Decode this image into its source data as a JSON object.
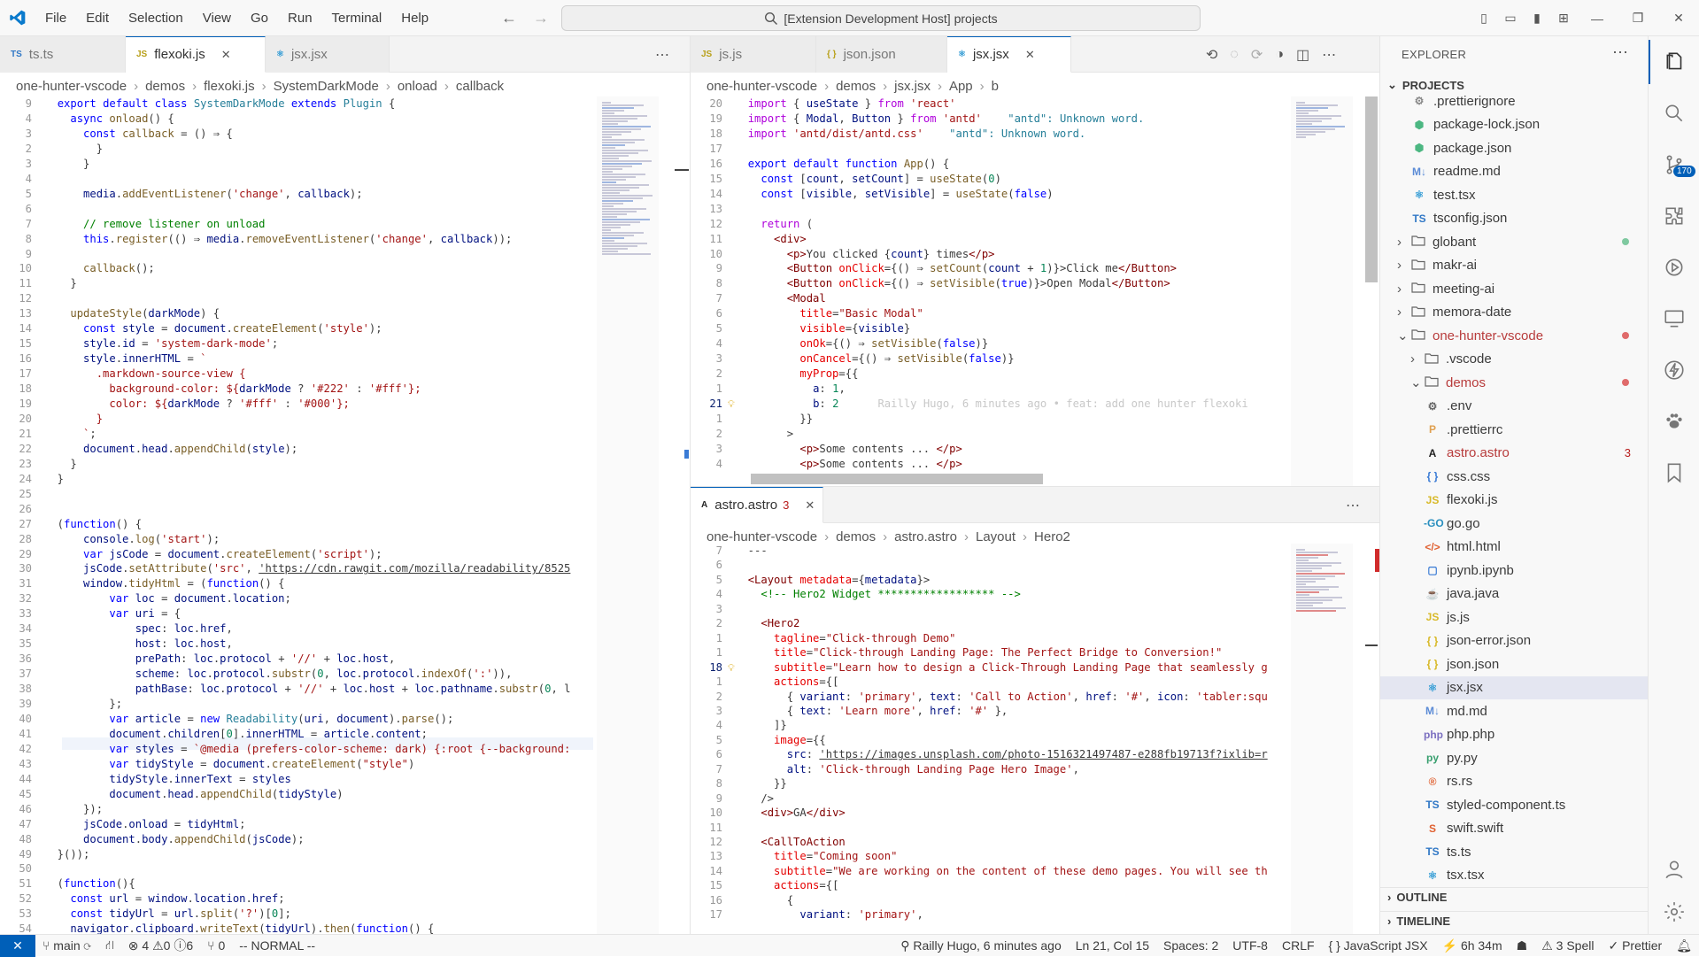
{
  "title_bar": {
    "menu": [
      "File",
      "Edit",
      "Selection",
      "View",
      "Go",
      "Run",
      "Terminal",
      "Help"
    ],
    "command_center": "[Extension Development Host] projects"
  },
  "left_editor": {
    "tabs": [
      {
        "label": "ts.ts",
        "icon": "TS"
      },
      {
        "label": "flexoki.js",
        "icon": "JS",
        "active": true
      },
      {
        "label": "jsx.jsx",
        "icon": "⚛"
      }
    ],
    "breadcrumb": [
      "one-hunter-vscode",
      "demos",
      "flexoki.js",
      "SystemDarkMode",
      "onload",
      "callback"
    ],
    "lines": [
      {
        "n": "9",
        "t": "  <k>export</k> <k>default</k> <k>class</k> <t>SystemDarkMode</t> <k>extends</k> <t>Plugin</t> {"
      },
      {
        "n": "4",
        "t": "    <k>async</k> <f>onload</f>() {"
      },
      {
        "n": "3",
        "t": "      <k>const</k> <f>callback</f> = () ⇒ {"
      },
      {
        "n": "2",
        "t": "        }"
      },
      {
        "n": "3",
        "t": "      }"
      },
      {
        "n": "4",
        "t": ""
      },
      {
        "n": "5",
        "t": "      <v>media</v>.<f>addEventListener</f>(<s>'change'</s>, <v>callback</v>);"
      },
      {
        "n": "6",
        "t": ""
      },
      {
        "n": "7",
        "t": "      <c>// remove listener on unload</c>"
      },
      {
        "n": "8",
        "t": "      <k>this</k>.<f>register</f>(() ⇒ <v>media</v>.<f>removeEventListener</f>(<s>'change'</s>, <v>callback</v>));"
      },
      {
        "n": "9",
        "t": ""
      },
      {
        "n": "10",
        "t": "      <f>callback</f>();"
      },
      {
        "n": "11",
        "t": "    }"
      },
      {
        "n": "12",
        "t": ""
      },
      {
        "n": "13",
        "t": "    <f>updateStyle</f>(<v>darkMode</v>) {"
      },
      {
        "n": "14",
        "t": "      <k>const</k> <v>style</v> = <v>document</v>.<f>createElement</f>(<s>'style'</s>);"
      },
      {
        "n": "15",
        "t": "      <v>style</v>.<v>id</v> = <s>'system-dark-mode'</s>;"
      },
      {
        "n": "16",
        "t": "      <v>style</v>.<v>innerHTML</v> = <s>`</s>"
      },
      {
        "n": "17",
        "t": "<s>        .markdown-source-view {</s>"
      },
      {
        "n": "18",
        "t": "<s>          background-color: ${</s><v>darkMode</v> ? <s>'#222'</s> : <s>'#fff'</s><s>};</s>"
      },
      {
        "n": "19",
        "t": "<s>          color: ${</s><v>darkMode</v> ? <s>'#fff'</s> : <s>'#000'</s><s>};</s>"
      },
      {
        "n": "20",
        "t": "<s>        }</s>"
      },
      {
        "n": "21",
        "t": "<s>      `</s>;"
      },
      {
        "n": "22",
        "t": "      <v>document</v>.<v>head</v>.<f>appendChild</f>(<v>style</v>);"
      },
      {
        "n": "23",
        "t": "    }"
      },
      {
        "n": "24",
        "t": "  }"
      },
      {
        "n": "25",
        "t": ""
      },
      {
        "n": "26",
        "t": ""
      },
      {
        "n": "27",
        "t": "  (<k>function</k>() {"
      },
      {
        "n": "28",
        "t": "      <v>console</v>.<f>log</f>(<s>'start'</s>);"
      },
      {
        "n": "29",
        "t": "      <k>var</k> <v>jsCode</v> = <v>document</v>.<f>createElement</f>(<s>'script'</s>);"
      },
      {
        "n": "30",
        "t": "      <v>jsCode</v>.<f>setAttribute</f>(<s>'src'</s>, <s class=\"u\">'https://cdn.rawgit.com/mozilla/readability/8525</s>"
      },
      {
        "n": "31",
        "t": "      <v>window</v>.<f>tidyHtml</f> = (<k>function</k>() {"
      },
      {
        "n": "32",
        "t": "          <k>var</k> <v>loc</v> = <v>document</v>.<v>location</v>;"
      },
      {
        "n": "33",
        "t": "          <k>var</k> <v>uri</v> = {"
      },
      {
        "n": "34",
        "t": "              <v>spec</v>: <v>loc</v>.<v>href</v>,"
      },
      {
        "n": "35",
        "t": "              <v>host</v>: <v>loc</v>.<v>host</v>,"
      },
      {
        "n": "36",
        "t": "              <v>prePath</v>: <v>loc</v>.<v>protocol</v> + <s>'//'</s> + <v>loc</v>.<v>host</v>,"
      },
      {
        "n": "37",
        "t": "              <v>scheme</v>: <v>loc</v>.<v>protocol</v>.<f>substr</f>(<n>0</n>, <v>loc</v>.<v>protocol</v>.<f>indexOf</f>(<s>':'</s>)),"
      },
      {
        "n": "38",
        "t": "              <v>pathBase</v>: <v>loc</v>.<v>protocol</v> + <s>'//'</s> + <v>loc</v>.<v>host</v> + <v>loc</v>.<v>pathname</v>.<f>substr</f>(<n>0</n>, l"
      },
      {
        "n": "39",
        "t": "          };"
      },
      {
        "n": "40",
        "t": "          <k>var</k> <v>article</v> = <k>new</k> <t>Readability</t>(<v>uri</v>, <v>document</v>).<f>parse</f>();"
      },
      {
        "n": "41",
        "t": "          <v>document</v>.<v>children</v>[<n>0</n>].<v>innerHTML</v> = <v>article</v>.<v>content</v>;"
      },
      {
        "n": "42",
        "t": "          <k>var</k> <v>styles</v> = <s>`@media (prefers-color-scheme: dark) {:root {--background:</s>"
      },
      {
        "n": "43",
        "t": "          <k>var</k> <v>tidyStyle</v> = <v>document</v>.<f>createElement</f>(<s>\"style\"</s>)"
      },
      {
        "n": "44",
        "t": "          <v>tidyStyle</v>.<v>innerText</v> = <v>styles</v>"
      },
      {
        "n": "45",
        "t": "          <v>document</v>.<v>head</v>.<f>appendChild</f>(<v>tidyStyle</v>)"
      },
      {
        "n": "46",
        "t": "      });"
      },
      {
        "n": "47",
        "t": "      <v>jsCode</v>.<v>onload</v> = <v>tidyHtml</v>;"
      },
      {
        "n": "48",
        "t": "      <v>document</v>.<v>body</v>.<f>appendChild</f>(<v>jsCode</v>);"
      },
      {
        "n": "49",
        "t": "  }());"
      },
      {
        "n": "50",
        "t": ""
      },
      {
        "n": "51",
        "t": "  (<k>function</k>(){"
      },
      {
        "n": "52",
        "t": "    <k>const</k> <v>url</v> = <v>window</v>.<v>location</v>.<v>href</v>;"
      },
      {
        "n": "53",
        "t": "    <k>const</k> <v>tidyUrl</v> = <v>url</v>.<f>split</f>(<s>'?'</s>)[<n>0</n>];"
      },
      {
        "n": "54",
        "t": "    <v>navigator</v>.<v>clipboard</v>.<f>writeText</f>(<v>tidyUrl</v>).<f>then</f>(<k>function</k>() {"
      }
    ]
  },
  "right_top_editor": {
    "tabs": [
      {
        "label": "js.js",
        "icon": "JS"
      },
      {
        "label": "json.json",
        "icon": "{ }"
      },
      {
        "label": "jsx.jsx",
        "icon": "⚛",
        "active": true
      }
    ],
    "breadcrumb": [
      "one-hunter-vscode",
      "demos",
      "jsx.jsx",
      "App",
      "b"
    ],
    "lines": [
      {
        "n": "20",
        "t": "  <kc>import</kc> { <v>useState</v> } <kc>from</kc> <s>'react'</s>"
      },
      {
        "n": "19",
        "t": "  <kc>import</kc> { <v>Modal</v>, <v>Button</v> } <kc>from</kc> <s>'antd'</s>    <span class=\"t\">\"antd\": Unknown word.</span>"
      },
      {
        "n": "18",
        "t": "  <kc>import</kc> <s>'antd/dist/antd.css'</s>    <span class=\"t\">\"antd\": Unknown word.</span>"
      },
      {
        "n": "17",
        "t": ""
      },
      {
        "n": "16",
        "t": "  <k>export</k> <k>default</k> <k>function</k> <f>App</f>() {"
      },
      {
        "n": "15",
        "t": "    <k>const</k> [<v>count</v>, <v>setCount</v>] = <f>useState</f>(<n>0</n>)"
      },
      {
        "n": "14",
        "t": "    <k>const</k> [<v>visible</v>, <v>setVisible</v>] = <f>useState</f>(<k>false</k>)"
      },
      {
        "n": "13",
        "t": ""
      },
      {
        "n": "12",
        "t": "    <kc>return</kc> ("
      },
      {
        "n": "11",
        "t": "      <tg>&lt;div&gt;</tg>"
      },
      {
        "n": "10",
        "t": "        <tg>&lt;p&gt;</tg>You clicked {<v>count</v>} times<tg>&lt;/p&gt;</tg>"
      },
      {
        "n": "9",
        "t": "        <tg>&lt;Button</tg> <at>onClick</at>={() ⇒ <f>setCount</f>(<v>count</v> + <n>1</n>)}&gt;Click me<tg>&lt;/Button&gt;</tg>"
      },
      {
        "n": "8",
        "t": "        <tg>&lt;Button</tg> <at>onClick</at>={() ⇒ <f>setVisible</f>(<k>true</k>)}&gt;Open Modal<tg>&lt;/Button&gt;</tg>"
      },
      {
        "n": "7",
        "t": "        <tg>&lt;Modal</tg>"
      },
      {
        "n": "6",
        "t": "          <at>title</at>=<s>\"Basic Modal\"</s>"
      },
      {
        "n": "5",
        "t": "          <at>visible</at>={<v>visible</v>}"
      },
      {
        "n": "4",
        "t": "          <at>onOk</at>={() ⇒ <f>setVisible</f>(<k>false</k>)}"
      },
      {
        "n": "3",
        "t": "          <at>onCancel</at>={() ⇒ <f>setVisible</f>(<k>false</k>)}"
      },
      {
        "n": "2",
        "t": "          <at>myProp</at>={{"
      },
      {
        "n": "1",
        "t": "            <v>a</v>: <n>1</n>,"
      },
      {
        "n": "21",
        "t": "            <v>b</v>: <n>2</n>      <span class=\"blame\">Railly Hugo, 6 minutes ago • feat: add one hunter flexoki</span>",
        "cur": true
      },
      {
        "n": "1",
        "t": "          }}"
      },
      {
        "n": "2",
        "t": "        &gt;"
      },
      {
        "n": "3",
        "t": "          <tg>&lt;p&gt;</tg>Some contents ... <tg>&lt;/p&gt;</tg>"
      },
      {
        "n": "4",
        "t": "          <tg>&lt;p&gt;</tg>Some contents ... <tg>&lt;/p&gt;</tg>"
      }
    ]
  },
  "right_bottom_editor": {
    "tabs": [
      {
        "label": "astro.astro",
        "icon": "A",
        "badge": "3",
        "active": true
      }
    ],
    "breadcrumb": [
      "one-hunter-vscode",
      "demos",
      "astro.astro",
      "Layout",
      "Hero2"
    ],
    "lines": [
      {
        "n": "7",
        "t": "  ---"
      },
      {
        "n": "6",
        "t": ""
      },
      {
        "n": "5",
        "t": "  <tg>&lt;Layout</tg> <at>metadata</at>={<v>metadata</v>}&gt;"
      },
      {
        "n": "4",
        "t": "    <c>&lt;!-- Hero2 Widget ****************** --&gt;</c>"
      },
      {
        "n": "3",
        "t": ""
      },
      {
        "n": "2",
        "t": "    <tg>&lt;Hero2</tg>"
      },
      {
        "n": "1",
        "t": "      <at>tagline</at>=<s>\"Click-through Demo\"</s>"
      },
      {
        "n": "1",
        "t": "      <at>title</at>=<s>\"Click-through Landing Page: The Perfect Bridge to Conversion!\"</s>"
      },
      {
        "n": "18",
        "t": "      <at>subtitle</at>=<s>\"Learn how to design a Click-Through Landing Page that seamlessly g</s>",
        "cur": true
      },
      {
        "n": "1",
        "t": "      <at>actions</at>={["
      },
      {
        "n": "2",
        "t": "        { <v>variant</v>: <s>'primary'</s>, <v>text</v>: <s>'Call to Action'</s>, <v>href</v>: <s>'#'</s>, <v>icon</v>: <s>'tabler:squ</s>"
      },
      {
        "n": "3",
        "t": "        { <v>text</v>: <s>'Learn more'</s>, <v>href</v>: <s>'#'</s> },"
      },
      {
        "n": "4",
        "t": "      ]}"
      },
      {
        "n": "5",
        "t": "      <at>image</at>={{"
      },
      {
        "n": "6",
        "t": "        <v>src</v>: <s class=\"u\">'https://images.unsplash.com/photo-1516321497487-e288fb19713f?ixlib=r</s>"
      },
      {
        "n": "7",
        "t": "        <v>alt</v>: <s>'Click-through Landing Page Hero Image'</s>,"
      },
      {
        "n": "8",
        "t": "      }}"
      },
      {
        "n": "9",
        "t": "    /&gt;"
      },
      {
        "n": "10",
        "t": "    <tg>&lt;div&gt;</tg>GA<tg>&lt;/div&gt;</tg>"
      },
      {
        "n": "11",
        "t": ""
      },
      {
        "n": "12",
        "t": "    <tg>&lt;CallToAction</tg>"
      },
      {
        "n": "13",
        "t": "      <at>title</at>=<s>\"Coming soon\"</s>"
      },
      {
        "n": "14",
        "t": "      <at>subtitle</at>=<s>\"We are working on the content of these demo pages. You will see th</s>"
      },
      {
        "n": "15",
        "t": "      <at>actions</at>={["
      },
      {
        "n": "16",
        "t": "        {"
      },
      {
        "n": "17",
        "t": "          <v>variant</v>: <s>'primary'</s>,"
      }
    ]
  },
  "explorer": {
    "header": "EXPLORER",
    "section": "PROJECTS",
    "outline": "OUTLINE",
    "timeline": "TIMELINE",
    "items": [
      {
        "label": ".prettierignore",
        "icon": "⚙",
        "color": "#888",
        "indent": 2
      },
      {
        "label": "package-lock.json",
        "icon": "⬢",
        "color": "#4cb782",
        "indent": 2
      },
      {
        "label": "package.json",
        "icon": "⬢",
        "color": "#4cb782",
        "indent": 2
      },
      {
        "label": "readme.md",
        "icon": "M↓",
        "color": "#5b8bd6",
        "indent": 2
      },
      {
        "label": "test.tsx",
        "icon": "⚛",
        "color": "#3a9fd6",
        "indent": 2
      },
      {
        "label": "tsconfig.json",
        "icon": "TS",
        "color": "#3178c6",
        "indent": 2
      },
      {
        "label": "globant",
        "folder": true,
        "indent": 1,
        "dot": "#7fc9a0"
      },
      {
        "label": "makr-ai",
        "folder": true,
        "indent": 1
      },
      {
        "label": "meeting-ai",
        "folder": true,
        "indent": 1
      },
      {
        "label": "memora-date",
        "folder": true,
        "indent": 1
      },
      {
        "label": "one-hunter-vscode",
        "folder": true,
        "open": true,
        "indent": 1,
        "color": "#b83c3c",
        "dot": "#e06b6b"
      },
      {
        "label": ".vscode",
        "folder": true,
        "indent": 2
      },
      {
        "label": "demos",
        "folder": true,
        "open": true,
        "indent": 2,
        "color": "#b83c3c",
        "dot": "#e06b6b"
      },
      {
        "label": ".env",
        "icon": "⚙",
        "color": "#666",
        "indent": 3
      },
      {
        "label": ".prettierrc",
        "icon": "P",
        "color": "#e0a050",
        "indent": 3
      },
      {
        "label": "astro.astro",
        "icon": "A",
        "color": "#222",
        "indent": 3,
        "color_label": "#b83c3c",
        "badge": "3"
      },
      {
        "label": "css.css",
        "icon": "{ }",
        "color": "#3a7bd5",
        "indent": 3
      },
      {
        "label": "flexoki.js",
        "icon": "JS",
        "color": "#d8b928",
        "indent": 3
      },
      {
        "label": "go.go",
        "icon": "-GO",
        "color": "#2a8fbf",
        "indent": 3
      },
      {
        "label": "html.html",
        "icon": "</>",
        "color": "#e06030",
        "indent": 3
      },
      {
        "label": "ipynb.ipynb",
        "icon": "▢",
        "color": "#3a7bd5",
        "indent": 3
      },
      {
        "label": "java.java",
        "icon": "☕",
        "color": "#d04040",
        "indent": 3
      },
      {
        "label": "js.js",
        "icon": "JS",
        "color": "#d8b928",
        "indent": 3
      },
      {
        "label": "json-error.json",
        "icon": "{ }",
        "color": "#d8b928",
        "indent": 3
      },
      {
        "label": "json.json",
        "icon": "{ }",
        "color": "#d8b928",
        "indent": 3
      },
      {
        "label": "jsx.jsx",
        "icon": "⚛",
        "color": "#3a9fd6",
        "indent": 3,
        "selected": true
      },
      {
        "label": "md.md",
        "icon": "M↓",
        "color": "#5b8bd6",
        "indent": 3
      },
      {
        "label": "php.php",
        "icon": "php",
        "color": "#7b6fc0",
        "indent": 3
      },
      {
        "label": "py.py",
        "icon": "py",
        "color": "#3aa070",
        "indent": 3
      },
      {
        "label": "rs.rs",
        "icon": "®",
        "color": "#e06030",
        "indent": 3
      },
      {
        "label": "styled-component.ts",
        "icon": "TS",
        "color": "#3178c6",
        "indent": 3
      },
      {
        "label": "swift.swift",
        "icon": "S",
        "color": "#e06030",
        "indent": 3
      },
      {
        "label": "ts.ts",
        "icon": "TS",
        "color": "#3178c6",
        "indent": 3
      },
      {
        "label": "tsx.tsx",
        "icon": "⚛",
        "color": "#3a9fd6",
        "indent": 3
      }
    ]
  },
  "activity": {
    "scm_badge": "170"
  },
  "status_bar": {
    "branch": "main",
    "errors": "4",
    "warnings": "0",
    "info": "6",
    "ports": "0",
    "mode": "-- NORMAL --",
    "blame": "Railly Hugo, 6 minutes ago",
    "position": "Ln 21, Col 15",
    "spaces": "Spaces: 2",
    "encoding": "UTF-8",
    "eol": "CRLF",
    "language": "JavaScript JSX",
    "time": "6h 34m",
    "spell": "3 Spell",
    "formatter": "Prettier"
  }
}
